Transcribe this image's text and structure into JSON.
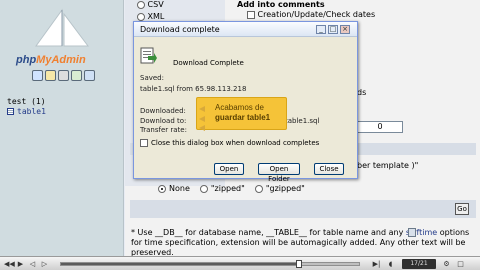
{
  "sidebar": {
    "logo": {
      "prefix": "php",
      "brand": "MyAdmin"
    },
    "nav_icons": [
      "home-icon",
      "sql-icon",
      "query-window-icon",
      "docs-icon",
      "help-icon"
    ],
    "database": "test (1)",
    "table": "table1"
  },
  "main": {
    "format_options": {
      "csv": "CSV",
      "xml": "XML"
    },
    "comments": {
      "heading": "Add into comments",
      "checkbox_label": "Creation/Update/Check dates"
    },
    "fragment_ds": "ds",
    "number_value": "0",
    "template_fragment": "ber template )\"",
    "compression": {
      "selected": "None",
      "options": [
        "None",
        "\"zipped\"",
        "\"gzipped\""
      ]
    },
    "go_label": "Go",
    "help": {
      "part1": "* Use __DB__ for database name, __TABLE__ for table name and any ",
      "link": "strftime",
      "part2": " options for time specification, extension will be automagically added. Any other text will be preserved."
    }
  },
  "dialog": {
    "title": "Download complete",
    "heading": "Download Complete",
    "saved_label": "Saved:",
    "saved_value": "table1.sql from 65.98.113.218",
    "downloaded_label": "Downloaded:",
    "download_to_label": "Download to:",
    "download_to_value": "C",
    "download_to_tail": "table1.sql",
    "transfer_rate_label": "Transfer rate:",
    "close_checkbox_label": "Close this dialog box when download completes",
    "buttons": {
      "open": "Open",
      "open_folder": "Open Folder",
      "close": "Close"
    },
    "title_buttons": {
      "minimize": "_",
      "maximize": "□",
      "close": "×"
    }
  },
  "tooltip": {
    "line1": "Acabamos de",
    "line2": "guardar table1"
  },
  "player": {
    "frame_counter": "17/21",
    "progress": 0.8,
    "controls": [
      "rewind-icon",
      "play-icon",
      "back-icon",
      "forward-icon",
      "end-icon",
      "volume-icon",
      "settings-icon"
    ]
  },
  "colors": {
    "sidebar_bg": "#d0dce0",
    "dialog_bg": "#ece9d8",
    "tooltip_bg": "#f5c338",
    "link": "#243c8a"
  }
}
